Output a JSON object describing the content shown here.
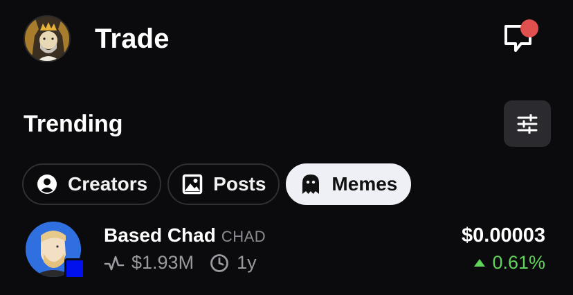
{
  "header": {
    "title": "Trade",
    "avatar_icon": "king-avatar",
    "chat_icon": "chat-bubble-icon",
    "notification_color": "#e0504f"
  },
  "trending": {
    "title": "Trending",
    "filter_icon": "sliders-icon"
  },
  "tabs": [
    {
      "label": "Creators",
      "icon": "user-circle-icon",
      "active": false
    },
    {
      "label": "Posts",
      "icon": "image-icon",
      "active": false
    },
    {
      "label": "Memes",
      "icon": "ghost-icon",
      "active": true
    }
  ],
  "coins": [
    {
      "name": "Based Chad",
      "ticker": "CHAD",
      "volume": "$1.93M",
      "age": "1y",
      "price": "$0.00003",
      "change": "0.61%",
      "change_direction": "up",
      "change_color": "#5fd35a",
      "chain_color": "#0011ee"
    }
  ]
}
